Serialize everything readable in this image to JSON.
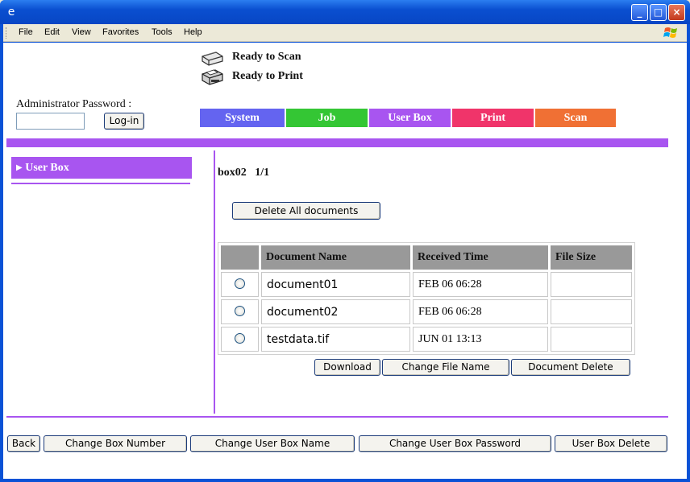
{
  "window": {
    "app_icon_glyph": "e",
    "controls": {
      "minimize": "_",
      "maximize": "□",
      "close": "×"
    }
  },
  "menubar": [
    "File",
    "Edit",
    "View",
    "Favorites",
    "Tools",
    "Help"
  ],
  "status": [
    {
      "text": "Ready to Scan",
      "icon": "scanner-icon"
    },
    {
      "text": "Ready to Print",
      "icon": "printer-icon"
    }
  ],
  "login": {
    "label": "Administrator Password :",
    "password_value": "",
    "button": "Log-in"
  },
  "tabs": [
    {
      "label": "System",
      "color": "#6464f0"
    },
    {
      "label": "Job",
      "color": "#34c634"
    },
    {
      "label": "User Box",
      "color": "#a855f0"
    },
    {
      "label": "Print",
      "color": "#f0346a"
    },
    {
      "label": "Scan",
      "color": "#f07034"
    }
  ],
  "sidebar": {
    "item": "User Box",
    "marker": "▶"
  },
  "box": {
    "name": "box02",
    "page": "1/1",
    "delete_all": "Delete All documents"
  },
  "table": {
    "columns": [
      "",
      "Document Name",
      "Received Time",
      "File Size"
    ],
    "rows": [
      {
        "name": "document01",
        "time": "FEB 06 06:28",
        "size": ""
      },
      {
        "name": "document02",
        "time": "FEB 06 06:28",
        "size": ""
      },
      {
        "name": "testdata.tif",
        "time": "JUN 01 13:13",
        "size": ""
      }
    ]
  },
  "doc_actions": [
    "Download",
    "Change File Name",
    "Document Delete"
  ],
  "bottom_actions": [
    "Back",
    "Change Box Number",
    "Change User Box Name",
    "Change User Box Password",
    "User Box Delete"
  ]
}
